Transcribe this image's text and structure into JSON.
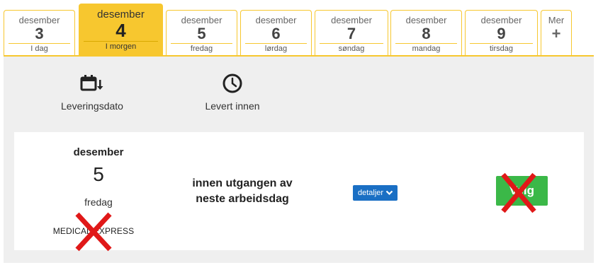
{
  "date_tabs": [
    {
      "month": "desember",
      "day": "3",
      "sub": "I dag"
    },
    {
      "month": "desember",
      "day": "4",
      "sub": "I morgen"
    },
    {
      "month": "desember",
      "day": "5",
      "sub": "fredag"
    },
    {
      "month": "desember",
      "day": "6",
      "sub": "lørdag"
    },
    {
      "month": "desember",
      "day": "7",
      "sub": "søndag"
    },
    {
      "month": "desember",
      "day": "8",
      "sub": "mandag"
    },
    {
      "month": "desember",
      "day": "9",
      "sub": "tirsdag"
    }
  ],
  "more_tab": {
    "label": "Mer",
    "symbol": "+"
  },
  "active_tab_index": 1,
  "sort_options": {
    "delivery_date": {
      "label": "Leveringsdato",
      "icon": "calendar-sort-icon"
    },
    "delivered_within": {
      "label": "Levert innen",
      "icon": "clock-icon"
    }
  },
  "option_card": {
    "month": "desember",
    "day": "5",
    "weekday": "fredag",
    "carrier": "MEDICAL EXPRESS",
    "window_line1": "innen utgangen av",
    "window_line2": "neste arbeidsdag",
    "details_label": "detaljer",
    "select_label": "Velg"
  },
  "colors": {
    "accent": "#f7c72f",
    "panel": "#efefef",
    "details_blue": "#1a6fc4",
    "select_green": "#3bb848",
    "x_mark_red": "#e01818"
  }
}
